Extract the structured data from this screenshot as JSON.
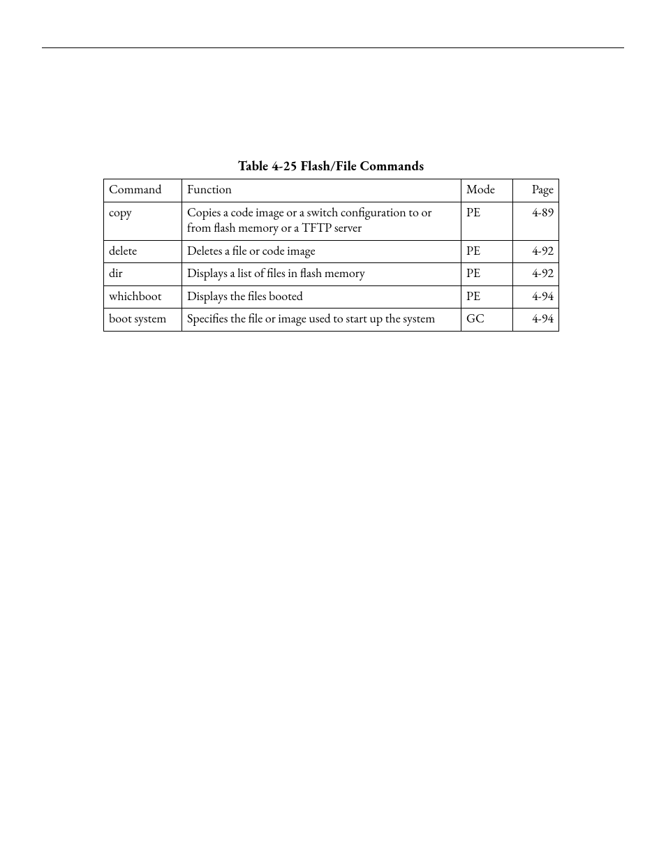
{
  "caption": "Table 4-25  Flash/File Commands",
  "headers": {
    "command": "Command",
    "function": "Function",
    "mode": "Mode",
    "page": "Page"
  },
  "rows": [
    {
      "command": "copy",
      "function": "Copies a code image or a switch configuration to or from flash memory or a TFTP server",
      "mode": "PE",
      "page": "4-89"
    },
    {
      "command": "delete",
      "function": "Deletes a file or code image",
      "mode": "PE",
      "page": "4-92"
    },
    {
      "command": "dir",
      "function": "Displays a list of files in flash memory",
      "mode": "PE",
      "page": "4-92"
    },
    {
      "command": "whichboot",
      "function": "Displays the files booted",
      "mode": "PE",
      "page": "4-94"
    },
    {
      "command": "boot system",
      "function": "Specifies the file or image used to start up the system",
      "mode": "GC",
      "page": "4-94"
    }
  ],
  "chart_data": {
    "type": "table",
    "title": "Table 4-25  Flash/File Commands",
    "columns": [
      "Command",
      "Function",
      "Mode",
      "Page"
    ],
    "rows": [
      [
        "copy",
        "Copies a code image or a switch configuration to or from flash memory or a TFTP server",
        "PE",
        "4-89"
      ],
      [
        "delete",
        "Deletes a file or code image",
        "PE",
        "4-92"
      ],
      [
        "dir",
        "Displays a list of files in flash memory",
        "PE",
        "4-92"
      ],
      [
        "whichboot",
        "Displays the files booted",
        "PE",
        "4-94"
      ],
      [
        "boot system",
        "Specifies the file or image used to start up the system",
        "GC",
        "4-94"
      ]
    ]
  }
}
